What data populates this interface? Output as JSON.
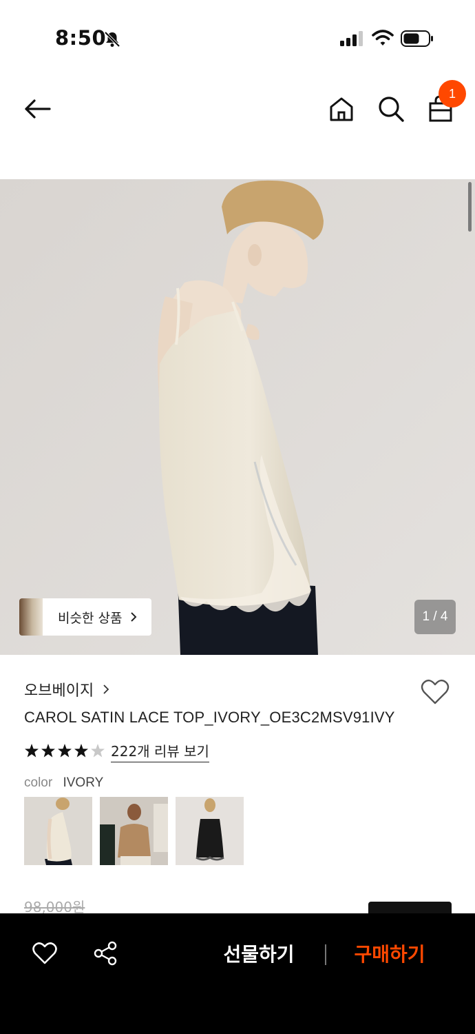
{
  "status_bar": {
    "time": "8:50",
    "icons": [
      "bell-off-icon",
      "signal-icon",
      "wifi-icon",
      "battery-icon"
    ]
  },
  "nav": {
    "icons": [
      "back-arrow-icon",
      "home-icon",
      "search-icon",
      "shopping-bag-icon"
    ],
    "cart_count": "1",
    "badge_color": "#ff4800"
  },
  "hero": {
    "similar_products_label": "비슷한 상품",
    "page_indicator": "1 / 4"
  },
  "product": {
    "brand": "오브베이지",
    "title": "CAROL SATIN LACE TOP_IVORY_OE3C2MSV91IVY",
    "rating": 4.5,
    "review_link": "222개 리뷰 보기",
    "color_label": "color",
    "color_value": "IVORY",
    "color_options": [
      {
        "name": "ivory-lace-top",
        "selected": true
      },
      {
        "name": "camel-cardigan-look",
        "selected": false
      },
      {
        "name": "black-lace-slip",
        "selected": false
      }
    ],
    "original_price": "98,000원"
  },
  "bottom_bar": {
    "icons": [
      "heart-icon",
      "share-icon"
    ],
    "gift_label": "선물하기",
    "buy_label": "구매하기",
    "accent_color": "#ff4800"
  }
}
